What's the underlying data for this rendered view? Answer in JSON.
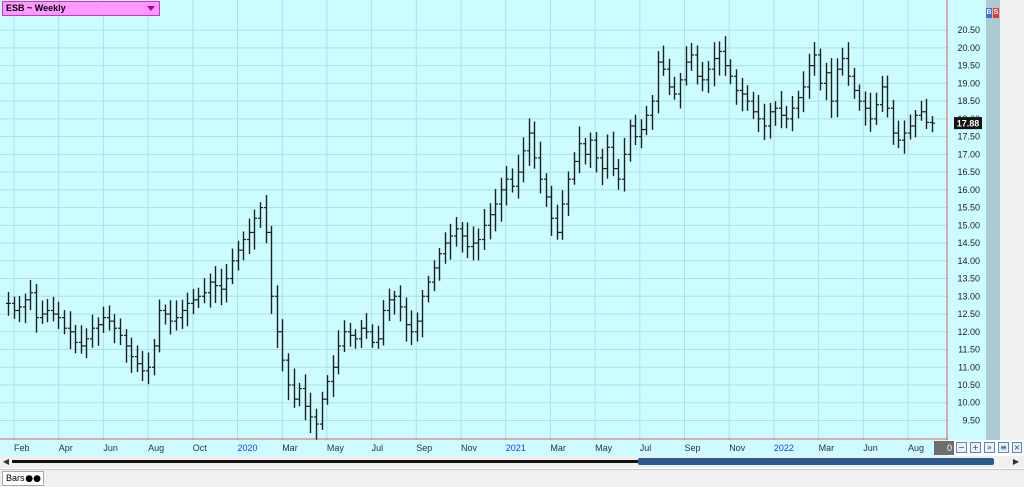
{
  "window": {
    "symbol_title": "ESB ~ Weekly",
    "last_price_label": "17.88",
    "corner_label": "0",
    "bottom_tab_label": "Bars"
  },
  "colors": {
    "plot_background": "#ccfcff",
    "grid": "#a9e3e6",
    "bar": "#1e1e1e",
    "year_label": "#1a3cff",
    "month_label": "#333333",
    "price_label_bg": "#111111",
    "symbol_box_bg": "#ff99ff",
    "right_border": "#e06060"
  },
  "chart_data": {
    "type": "ohlc",
    "title": "ESB ~ Weekly",
    "ylim": [
      8.95,
      21.35
    ],
    "yticks": [
      "20.50",
      "20.00",
      "19.50",
      "19.00",
      "18.50",
      "18.00",
      "17.50",
      "17.00",
      "16.50",
      "16.00",
      "15.50",
      "15.00",
      "14.50",
      "14.00",
      "13.50",
      "13.00",
      "12.50",
      "12.00",
      "11.50",
      "11.00",
      "10.50",
      "10.00",
      "9.50"
    ],
    "xticks": [
      {
        "label": "Feb",
        "year": false
      },
      {
        "label": "Apr",
        "year": false
      },
      {
        "label": "Jun",
        "year": false
      },
      {
        "label": "Aug",
        "year": false
      },
      {
        "label": "Oct",
        "year": false
      },
      {
        "label": "2020",
        "year": true
      },
      {
        "label": "Mar",
        "year": false
      },
      {
        "label": "May",
        "year": false
      },
      {
        "label": "Jul",
        "year": false
      },
      {
        "label": "Sep",
        "year": false
      },
      {
        "label": "Nov",
        "year": false
      },
      {
        "label": "2021",
        "year": true
      },
      {
        "label": "Mar",
        "year": false
      },
      {
        "label": "May",
        "year": false
      },
      {
        "label": "Jul",
        "year": false
      },
      {
        "label": "Sep",
        "year": false
      },
      {
        "label": "Nov",
        "year": false
      },
      {
        "label": "2022",
        "year": true
      },
      {
        "label": "Mar",
        "year": false
      },
      {
        "label": "Jun",
        "year": false
      },
      {
        "label": "Aug",
        "year": false
      }
    ],
    "last_price": 17.88,
    "grid": true,
    "close_series": [
      12.8,
      12.6,
      12.7,
      12.9,
      13.1,
      12.4,
      12.5,
      12.6,
      12.5,
      12.4,
      12.1,
      12.0,
      11.7,
      11.6,
      11.8,
      12.1,
      12.2,
      12.4,
      12.3,
      12.1,
      11.9,
      11.6,
      11.3,
      11.1,
      10.9,
      11.0,
      11.6,
      12.6,
      12.5,
      12.3,
      12.4,
      12.6,
      12.8,
      12.9,
      13.0,
      13.1,
      13.4,
      13.3,
      13.2,
      13.5,
      14.0,
      14.3,
      14.6,
      14.8,
      15.2,
      15.5,
      14.8,
      13.0,
      12.0,
      11.2,
      10.5,
      10.1,
      10.4,
      9.9,
      9.6,
      9.4,
      10.1,
      10.6,
      11.0,
      11.6,
      12.0,
      11.9,
      11.8,
      12.1,
      12.0,
      11.7,
      11.8,
      12.6,
      12.9,
      13.0,
      12.7,
      12.2,
      12.0,
      12.3,
      13.0,
      13.4,
      13.8,
      14.2,
      14.5,
      14.7,
      14.9,
      14.7,
      14.4,
      14.5,
      14.6,
      15.0,
      15.3,
      15.6,
      16.0,
      16.3,
      16.1,
      16.5,
      17.1,
      17.6,
      16.9,
      16.3,
      15.8,
      15.2,
      14.8,
      15.6,
      16.3,
      16.8,
      17.3,
      17.0,
      17.4,
      16.9,
      16.6,
      17.2,
      16.6,
      16.3,
      17.0,
      17.8,
      17.5,
      17.7,
      18.1,
      18.5,
      19.6,
      19.4,
      18.9,
      18.7,
      19.1,
      19.6,
      19.8,
      19.2,
      19.1,
      19.4,
      19.7,
      19.9,
      19.5,
      19.2,
      18.8,
      18.7,
      18.5,
      18.2,
      18.0,
      17.8,
      18.2,
      18.3,
      18.1,
      18.0,
      18.3,
      18.6,
      18.9,
      19.5,
      19.8,
      19.0,
      19.3,
      18.5,
      19.4,
      19.7,
      19.2,
      18.8,
      18.5,
      18.3,
      18.0,
      18.4,
      18.9,
      18.3,
      17.6,
      17.4,
      17.6,
      17.8,
      18.1,
      18.2,
      17.9,
      17.88
    ]
  }
}
